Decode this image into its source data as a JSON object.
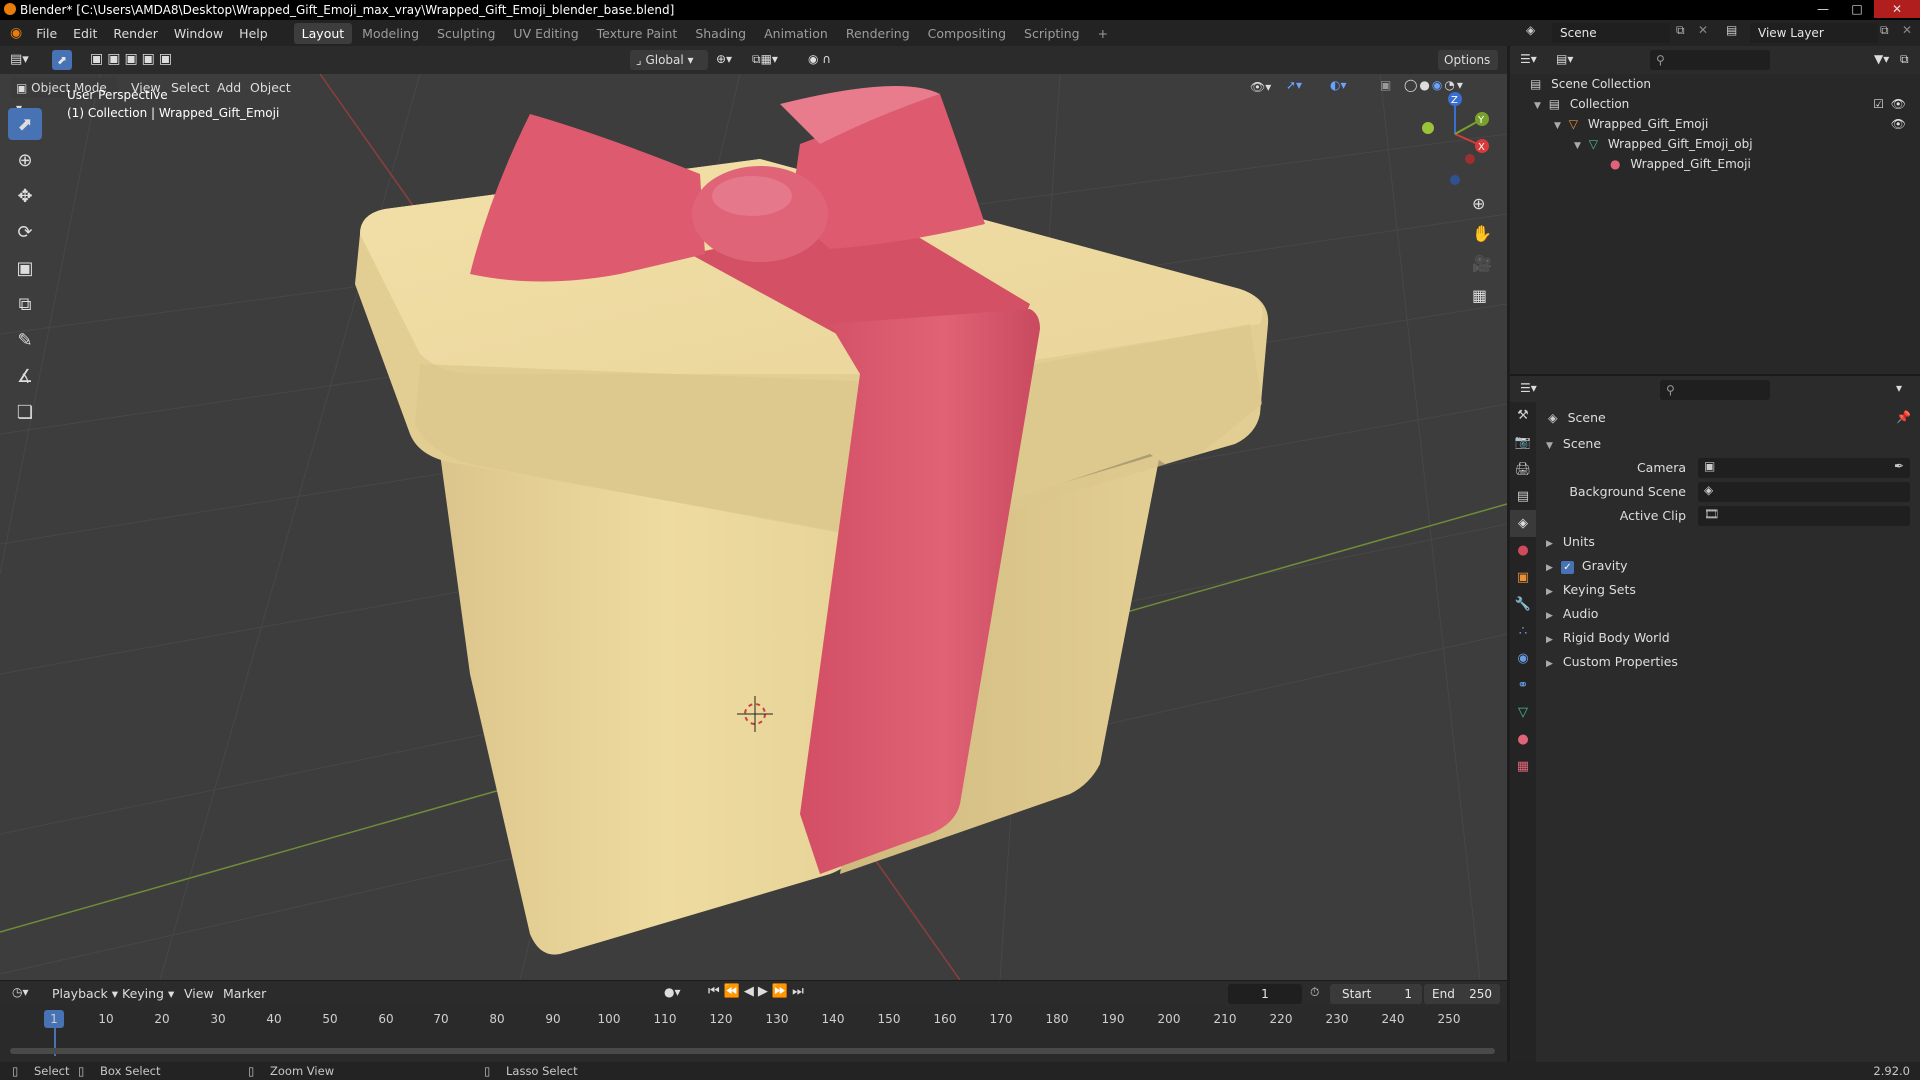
{
  "window": {
    "title": "Blender* [C:\\Users\\AMDA8\\Desktop\\Wrapped_Gift_Emoji_max_vray\\Wrapped_Gift_Emoji_blender_base.blend]"
  },
  "menu": [
    "File",
    "Edit",
    "Render",
    "Window",
    "Help"
  ],
  "workspaces": [
    "Layout",
    "Modeling",
    "Sculpting",
    "UV Editing",
    "Texture Paint",
    "Shading",
    "Animation",
    "Rendering",
    "Compositing",
    "Scripting",
    "+"
  ],
  "header": {
    "scene_label": "Scene",
    "view_layer_label": "View Layer",
    "orientation": "Global",
    "options": "Options"
  },
  "viewport": {
    "mode": "Object Mode",
    "menus": [
      "View",
      "Select",
      "Add",
      "Object"
    ],
    "overlay_line1": "User Perspective",
    "overlay_line2": "(1) Collection | Wrapped_Gift_Emoji",
    "gizmo_axes": [
      "X",
      "Y",
      "Z"
    ]
  },
  "outliner": {
    "items": [
      "Scene Collection",
      "Collection",
      "Wrapped_Gift_Emoji",
      "Wrapped_Gift_Emoji_obj",
      "Wrapped_Gift_Emoji"
    ]
  },
  "properties": {
    "breadcrumb": "Scene",
    "panel_title": "Scene",
    "fields": [
      "Camera",
      "Background Scene",
      "Active Clip"
    ],
    "subpanels": [
      "Units",
      "Gravity",
      "Keying Sets",
      "Audio",
      "Rigid Body World",
      "Custom Properties"
    ],
    "gravity_checked": true
  },
  "timeline": {
    "menus": [
      "Playback",
      "Keying",
      "View",
      "Marker"
    ],
    "current_frame": "1",
    "start_label": "Start",
    "start_value": "1",
    "end_label": "End",
    "end_value": "250",
    "ticks": [
      "1",
      "10",
      "20",
      "30",
      "40",
      "50",
      "60",
      "70",
      "80",
      "90",
      "100",
      "110",
      "120",
      "130",
      "140",
      "150",
      "160",
      "170",
      "180",
      "190",
      "200",
      "210",
      "220",
      "230",
      "240",
      "250"
    ]
  },
  "status": {
    "select": "Select",
    "box_select": "Box Select",
    "zoom_view": "Zoom View",
    "lasso_select": "Lasso Select",
    "version": "2.92.0"
  },
  "colors": {
    "accent": "#4772b3",
    "gift_box": "#e9d59a",
    "ribbon": "#d9566a",
    "viewport_bg": "#3d3d3d"
  }
}
